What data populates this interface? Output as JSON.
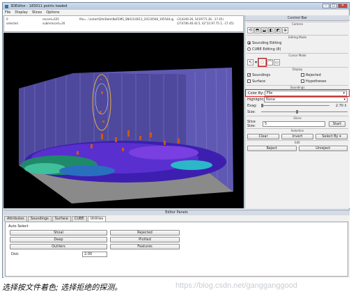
{
  "window": {
    "title": "3DEditor - 183011 points loaded"
  },
  "window_buttons": {
    "minimize": "–",
    "maximize": "□",
    "close": "✕"
  },
  "menu": [
    "File",
    "Display",
    "Slices",
    "Options"
  ],
  "info": {
    "col1": [
      "0",
      "selected"
    ],
    "col2": [
      "record=635",
      "submrecord=26"
    ],
    "col3": [
      "file=...\\icstart\\DimData\\NoFEMS_SN011\\0013_20110508_195546.qprd 6b)"
    ],
    "col4": [
      "(314249.26, 5419771.36, -17.45)",
      "(274746.46.43.5, 42°22.97.75.1, -17.45)"
    ]
  },
  "control_bar": {
    "title": "Control Bar",
    "camera_label": "Camera",
    "editing_mode_label": "Editing Mode",
    "editing_modes": [
      "Sounding Editing",
      "CUBE Editing (8)"
    ],
    "cursor_mode_label": "Cursor Mode",
    "display_label": "Display",
    "display_opts": {
      "soundings": "Soundings",
      "rejected": "Rejected",
      "surface": "Surface",
      "hypotheses": "Hypotheses"
    },
    "soundings_label": "Soundings",
    "color_by_label": "Color By:",
    "color_by_value": "File",
    "highlight_label": "Highlight:",
    "highlight_value": "None",
    "exag_label": "Exag:",
    "exag_value": "2.70",
    "size_label": "Size:",
    "slices_label": "Slices",
    "slice_size_label": "Slice Size:",
    "slice_size_value": "5",
    "start_label": "Start",
    "selection_label": "Selection",
    "clear_label": "Clear",
    "invert_label": "Invert",
    "select_by_label": "Select By",
    "edit_label": "Edit",
    "reject_label": "Reject",
    "unreject_label": "Unreject"
  },
  "editor_panels": {
    "title": "Editor Panels",
    "tabs": [
      "Attributes",
      "Soundings",
      "Surface",
      "CUBE",
      "Utilities"
    ],
    "auto_select_label": "Auto Select",
    "buttons_left": [
      "Shoal",
      "Deep",
      "Outliers"
    ],
    "buttons_right": [
      "Rejected",
      "Plotted",
      "Features"
    ],
    "dist_label": "Dist:",
    "dist_value": "2.00"
  },
  "caption": "选择按文件着色; 选择拒绝的探测。",
  "watermark": "https://blog.csdn.net/gangganggood",
  "colors": {
    "accent_red": "#e02020",
    "viewport_bg": "#000000",
    "bounding_box": "#9b8ce0"
  }
}
